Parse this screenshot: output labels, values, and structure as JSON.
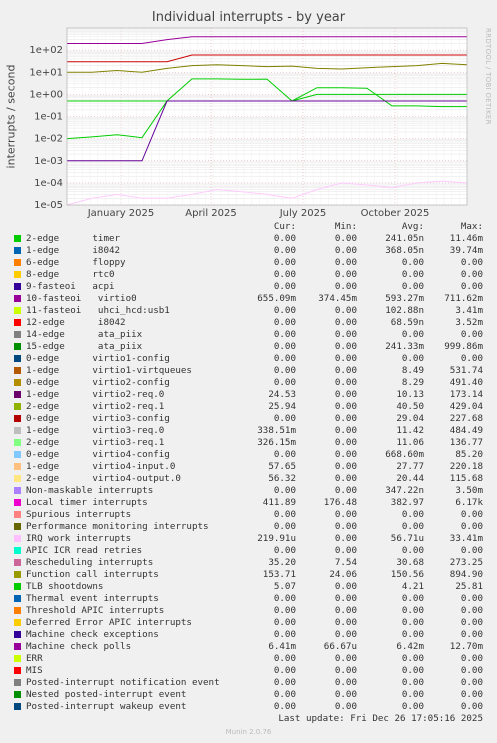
{
  "title": "Individual interrupts - by year",
  "side_label": "RRDTOOL / TOBI OETIKER",
  "chart_data": {
    "type": "line",
    "title": "Individual interrupts - by year",
    "ylabel": "interrupts / second",
    "yscale": "log",
    "ylim": [
      1e-05,
      1000
    ],
    "y_ticks": [
      "1e+02",
      "1e+01",
      "1e+00",
      "1e-01",
      "1e-02",
      "1e-03",
      "1e-04",
      "1e-05"
    ],
    "x_ticks": [
      "January 2025",
      "April 2025",
      "July 2025",
      "October 2025"
    ],
    "grid": true,
    "legend_placement": "bottom",
    "series": [
      {
        "name": "timer",
        "color": "#00cc00",
        "values": [
          0.01,
          0.012,
          0.015,
          0.011,
          0.5,
          5,
          5,
          4.8,
          4.9,
          0.5,
          2,
          2,
          1.9,
          0.3,
          0.3,
          0.28,
          0.28
        ]
      },
      {
        "name": "virtio0",
        "color": "#990099",
        "values": [
          200,
          200,
          200,
          200,
          300,
          400,
          400,
          400,
          400,
          400,
          400,
          400,
          400,
          400,
          400,
          400,
          400
        ]
      },
      {
        "name": "virtio3-req.0",
        "color": "#00cc00",
        "values": [
          0.5,
          0.5,
          0.5,
          0.5,
          0.5,
          0.5,
          0.5,
          0.5,
          0.5,
          0.5,
          1.0,
          1.0,
          1.0,
          1.0,
          1.0,
          1.0,
          1.0
        ]
      },
      {
        "name": "Local timer interrupts",
        "color": "#cc0000",
        "values": [
          30,
          30,
          30,
          30,
          30,
          60,
          60,
          60,
          60,
          60,
          60,
          60,
          60,
          60,
          60,
          60,
          60
        ]
      },
      {
        "name": "Function call interrupts",
        "color": "#808000",
        "values": [
          10,
          10,
          12,
          10,
          15,
          20,
          22,
          20,
          18,
          19,
          15,
          14,
          16,
          18,
          20,
          25,
          22
        ]
      },
      {
        "name": "virtio2-req.0",
        "color": "#660099",
        "values": [
          0.001,
          0.001,
          0.001,
          0.001,
          0.5,
          0.5,
          0.5,
          0.5,
          0.5,
          0.5,
          0.5,
          0.5,
          0.5,
          0.5,
          0.5,
          0.5,
          0.5
        ]
      },
      {
        "name": "IRQ work interrupts",
        "color": "#ffccff",
        "values": [
          1e-05,
          2e-05,
          3e-05,
          2e-05,
          2e-05,
          3e-05,
          5e-05,
          4e-05,
          3e-05,
          2e-05,
          5e-05,
          0.0001,
          8e-05,
          6e-05,
          0.0001,
          0.00012,
          0.0001
        ]
      }
    ]
  },
  "legend": {
    "headers": {
      "cur": "Cur:",
      "min": "Min:",
      "avg": "Avg:",
      "max": "Max:"
    },
    "rows": [
      {
        "name": "2-edge      timer",
        "color": "#00cc00",
        "cur": "0.00",
        "min": "0.00",
        "avg": "241.05n",
        "max": "11.46m"
      },
      {
        "name": "1-edge      i8042",
        "color": "#0066b3",
        "cur": "0.00",
        "min": "0.00",
        "avg": "368.05n",
        "max": "39.74m"
      },
      {
        "name": "6-edge      floppy",
        "color": "#ff8000",
        "cur": "0.00",
        "min": "0.00",
        "avg": "0.00",
        "max": "0.00"
      },
      {
        "name": "8-edge      rtc0",
        "color": "#ffcc00",
        "cur": "0.00",
        "min": "0.00",
        "avg": "0.00",
        "max": "0.00"
      },
      {
        "name": "9-fasteoi   acpi",
        "color": "#330099",
        "cur": "0.00",
        "min": "0.00",
        "avg": "0.00",
        "max": "0.00"
      },
      {
        "name": "10-fasteoi   virtio0",
        "color": "#990099",
        "cur": "655.09m",
        "min": "374.45m",
        "avg": "593.27m",
        "max": "711.62m"
      },
      {
        "name": "11-fasteoi   uhci_hcd:usb1",
        "color": "#ccff00",
        "cur": "0.00",
        "min": "0.00",
        "avg": "102.88n",
        "max": "3.41m"
      },
      {
        "name": "12-edge      i8042",
        "color": "#ff0000",
        "cur": "0.00",
        "min": "0.00",
        "avg": "68.59n",
        "max": "3.52m"
      },
      {
        "name": "14-edge      ata_piix",
        "color": "#808080",
        "cur": "0.00",
        "min": "0.00",
        "avg": "0.00",
        "max": "0.00"
      },
      {
        "name": "15-edge      ata_piix",
        "color": "#008f00",
        "cur": "0.00",
        "min": "0.00",
        "avg": "241.33m",
        "max": "999.86m"
      },
      {
        "name": "0-edge      virtio1-config",
        "color": "#00487d",
        "cur": "0.00",
        "min": "0.00",
        "avg": "0.00",
        "max": "0.00"
      },
      {
        "name": "1-edge      virtio1-virtqueues",
        "color": "#b35a00",
        "cur": "0.00",
        "min": "0.00",
        "avg": "8.49",
        "max": "531.74"
      },
      {
        "name": "0-edge      virtio2-config",
        "color": "#b38f00",
        "cur": "0.00",
        "min": "0.00",
        "avg": "8.29",
        "max": "491.40"
      },
      {
        "name": "1-edge      virtio2-req.0",
        "color": "#6b006b",
        "cur": "24.53",
        "min": "0.00",
        "avg": "10.13",
        "max": "173.14"
      },
      {
        "name": "2-edge      virtio2-req.1",
        "color": "#8fb300",
        "cur": "25.94",
        "min": "0.00",
        "avg": "40.50",
        "max": "429.04"
      },
      {
        "name": "0-edge      virtio3-config",
        "color": "#b30000",
        "cur": "0.00",
        "min": "0.00",
        "avg": "29.04",
        "max": "227.68"
      },
      {
        "name": "1-edge      virtio3-req.0",
        "color": "#bebebe",
        "cur": "338.51m",
        "min": "0.00",
        "avg": "11.42",
        "max": "484.49"
      },
      {
        "name": "2-edge      virtio3-req.1",
        "color": "#80ff80",
        "cur": "326.15m",
        "min": "0.00",
        "avg": "11.06",
        "max": "136.77"
      },
      {
        "name": "0-edge      virtio4-config",
        "color": "#80c9ff",
        "cur": "0.00",
        "min": "0.00",
        "avg": "668.60m",
        "max": "85.20"
      },
      {
        "name": "1-edge      virtio4-input.0",
        "color": "#ffc080",
        "cur": "57.65",
        "min": "0.00",
        "avg": "27.77",
        "max": "220.18"
      },
      {
        "name": "2-edge      virtio4-output.0",
        "color": "#ffe680",
        "cur": "56.32",
        "min": "0.00",
        "avg": "20.44",
        "max": "115.68"
      },
      {
        "name": "Non-maskable interrupts",
        "color": "#aa80ff",
        "cur": "0.00",
        "min": "0.00",
        "avg": "347.22n",
        "max": "3.50m"
      },
      {
        "name": "Local timer interrupts",
        "color": "#ee00cc",
        "cur": "411.89",
        "min": "176.48",
        "avg": "382.97",
        "max": "6.17k"
      },
      {
        "name": "Spurious interrupts",
        "color": "#ff8080",
        "cur": "0.00",
        "min": "0.00",
        "avg": "0.00",
        "max": "0.00"
      },
      {
        "name": "Performance monitoring interrupts",
        "color": "#666600",
        "cur": "0.00",
        "min": "0.00",
        "avg": "0.00",
        "max": "0.00"
      },
      {
        "name": "IRQ work interrupts",
        "color": "#ffbfff",
        "cur": "219.91u",
        "min": "0.00",
        "avg": "56.71u",
        "max": "33.41m"
      },
      {
        "name": "APIC ICR read retries",
        "color": "#00ffcc",
        "cur": "0.00",
        "min": "0.00",
        "avg": "0.00",
        "max": "0.00"
      },
      {
        "name": "Rescheduling interrupts",
        "color": "#cc6699",
        "cur": "35.20",
        "min": "7.54",
        "avg": "30.68",
        "max": "273.25"
      },
      {
        "name": "Function call interrupts",
        "color": "#999900",
        "cur": "153.71",
        "min": "24.06",
        "avg": "150.56",
        "max": "894.90"
      },
      {
        "name": "TLB shootdowns",
        "color": "#00cc00",
        "cur": "5.07",
        "min": "0.00",
        "avg": "4.21",
        "max": "25.81"
      },
      {
        "name": "Thermal event interrupts",
        "color": "#0066b3",
        "cur": "0.00",
        "min": "0.00",
        "avg": "0.00",
        "max": "0.00"
      },
      {
        "name": "Threshold APIC interrupts",
        "color": "#ff8000",
        "cur": "0.00",
        "min": "0.00",
        "avg": "0.00",
        "max": "0.00"
      },
      {
        "name": "Deferred Error APIC interrupts",
        "color": "#ffcc00",
        "cur": "0.00",
        "min": "0.00",
        "avg": "0.00",
        "max": "0.00"
      },
      {
        "name": "Machine check exceptions",
        "color": "#330099",
        "cur": "0.00",
        "min": "0.00",
        "avg": "0.00",
        "max": "0.00"
      },
      {
        "name": "Machine check polls",
        "color": "#990099",
        "cur": "6.41m",
        "min": "66.67u",
        "avg": "6.42m",
        "max": "12.70m"
      },
      {
        "name": "ERR",
        "color": "#ccff00",
        "cur": "0.00",
        "min": "0.00",
        "avg": "0.00",
        "max": "0.00"
      },
      {
        "name": "MIS",
        "color": "#ff0000",
        "cur": "0.00",
        "min": "0.00",
        "avg": "0.00",
        "max": "0.00"
      },
      {
        "name": "Posted-interrupt notification event",
        "color": "#808080",
        "cur": "0.00",
        "min": "0.00",
        "avg": "0.00",
        "max": "0.00"
      },
      {
        "name": "Nested posted-interrupt event",
        "color": "#008f00",
        "cur": "0.00",
        "min": "0.00",
        "avg": "0.00",
        "max": "0.00"
      },
      {
        "name": "Posted-interrupt wakeup event",
        "color": "#00487d",
        "cur": "0.00",
        "min": "0.00",
        "avg": "0.00",
        "max": "0.00"
      }
    ]
  },
  "last_update": "Last update: Fri Dec 26 17:05:16 2025",
  "munin_version": "Munin 2.0.76"
}
